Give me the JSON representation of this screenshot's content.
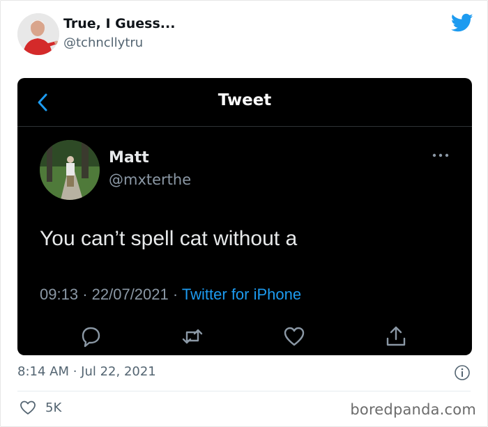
{
  "author": {
    "display_name": "True, I Guess...",
    "handle": "@tchncllytru",
    "avatar_icon": "man-pointing-avatar"
  },
  "platform_icon": "twitter-bird-icon",
  "embedded_tweet": {
    "header_title": "Tweet",
    "back_icon": "chevron-left-icon",
    "author_name": "Matt",
    "author_handle": "@mxterthe",
    "text": "You can’t spell cat without a",
    "time": "09:13",
    "separator": "·",
    "date": "22/07/2021",
    "source": "Twitter for iPhone",
    "accent_color": "#1d9bf0",
    "actions": [
      "reply-icon",
      "retweet-icon",
      "like-icon",
      "share-icon"
    ]
  },
  "footer": {
    "timestamp": "8:14 AM · Jul 22, 2021",
    "like_count": "5K",
    "watermark": "boredpanda.com"
  },
  "colors": {
    "twitter_blue": "#1d9bf0",
    "screenshot_bg": "#000000"
  }
}
